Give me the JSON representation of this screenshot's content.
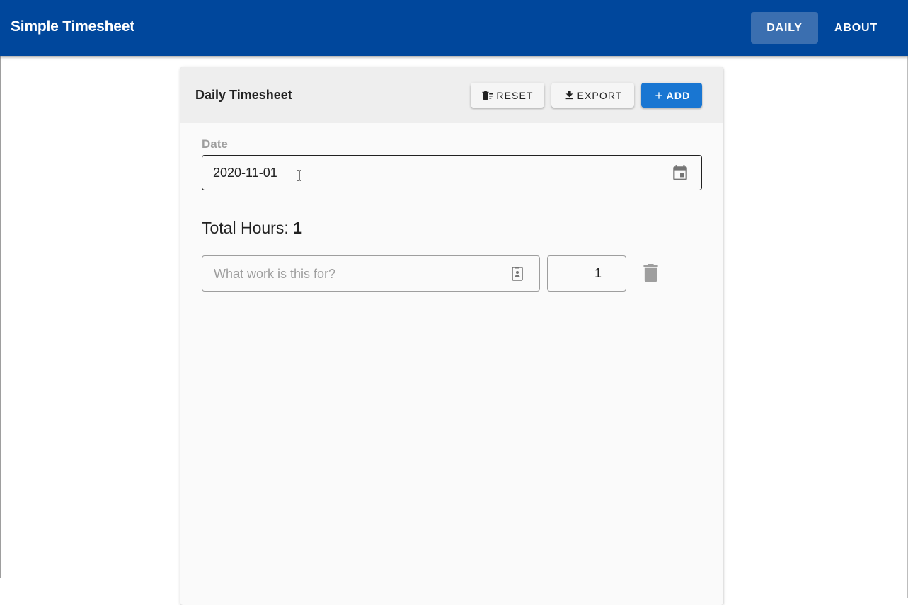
{
  "app": {
    "title": "Simple Timesheet",
    "nav": [
      {
        "label": "DAILY",
        "active": true
      },
      {
        "label": "ABOUT",
        "active": false
      }
    ],
    "brand_color": "#00479c"
  },
  "card": {
    "title": "Daily Timesheet",
    "actions": {
      "reset_label": "RESET",
      "reset_icon": "delete-sweep-icon",
      "export_label": "EXPORT",
      "export_icon": "download-icon",
      "add_label": "ADD",
      "add_icon": "plus-icon",
      "add_color": "#1976d2"
    },
    "date": {
      "label": "Date",
      "value": "2020-11-01",
      "icon": "calendar-icon"
    },
    "total": {
      "label": "Total Hours:",
      "value": "1"
    },
    "entries": [
      {
        "work_placeholder": "What work is this for?",
        "work_value": "",
        "work_icon": "contact-card-icon",
        "hours": "1",
        "delete_icon": "trash-icon"
      }
    ]
  }
}
